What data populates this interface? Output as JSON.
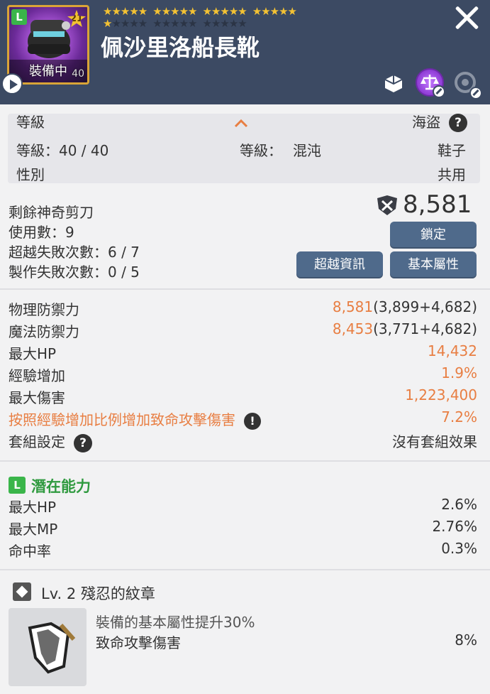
{
  "header": {
    "grade": "L",
    "star_count": "21",
    "equip_status": "裝備中",
    "equip_level": "40",
    "item_name": "佩沙里洛船長靴",
    "stars_top": [
      "★★★★★",
      "★★★★★",
      "★★★★★",
      "★★★★★"
    ],
    "stars_bottom_gold": "★",
    "stars_bottom_grey": [
      "★★★★",
      "★★★★★",
      "★★★★★"
    ],
    "close_icon": "close-icon",
    "action_icons": [
      "share-icon",
      "scale-icon",
      "reset-icon"
    ]
  },
  "basic": {
    "partial_left": "等級",
    "partial_right": "海盜",
    "level_req": "等級：40 / 40",
    "grade_label": "等級：",
    "grade_value": "混沌",
    "category": "鞋子",
    "gender_label": "性別",
    "gender_value": "共用"
  },
  "scissors": {
    "remaining": "剩餘神奇剪刀",
    "usage": "使用數：9",
    "transcend_fail": "超越失敗次數：6 / 7",
    "craft_fail": "製作失敗次數：0 / 5",
    "power": "8,581",
    "lock_button": "鎖定",
    "transcend_info_button": "超越資訊",
    "base_attr_button": "基本屬性"
  },
  "stats": [
    {
      "label": "物理防禦力",
      "value_main": "8,581",
      "value_detail": "(3,899+4,682)"
    },
    {
      "label": "魔法防禦力",
      "value_main": "8,453",
      "value_detail": "(3,771+4,682)"
    },
    {
      "label": "最大HP",
      "value_main": "14,432",
      "value_detail": ""
    },
    {
      "label": "經驗增加",
      "value_main": "1.9%",
      "value_detail": ""
    },
    {
      "label": "最大傷害",
      "value_main": "1,223,400",
      "value_detail": ""
    },
    {
      "label": "按照經驗增加比例增加致命攻擊傷害",
      "value_main": "7.2%",
      "value_detail": ""
    }
  ],
  "set": {
    "label": "套組設定",
    "value": "沒有套組效果"
  },
  "potential": {
    "grade": "L",
    "title": "潛在能力",
    "lines": [
      {
        "label": "最大HP",
        "value": "2.6%"
      },
      {
        "label": "最大MP",
        "value": "2.76%"
      },
      {
        "label": "命中率",
        "value": "0.3%"
      }
    ]
  },
  "emblem": {
    "title": "Lv. 2 殘忍的紋章",
    "line1": "裝備的基本屬性提升30%",
    "line2_label": "致命攻擊傷害",
    "line2_value": "8%"
  },
  "colors": {
    "header_bg": "#3c4a63",
    "accent_orange": "#e87e42",
    "potential_green": "#2f9a3f",
    "button_blue": "#4f6a8b"
  }
}
